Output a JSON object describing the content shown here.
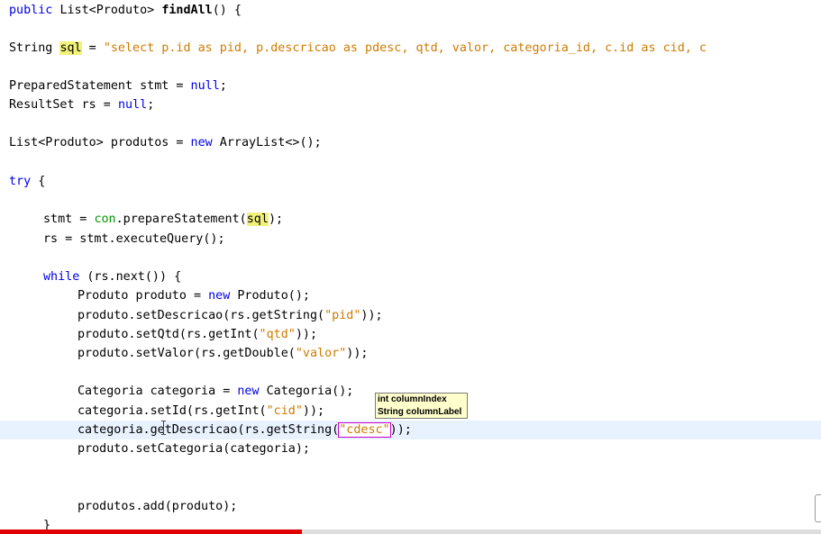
{
  "code": {
    "l1": {
      "kw": "public",
      "type": "List<Produto>",
      "method": "findAll",
      "rest": "() {"
    },
    "l2": {
      "type": "String",
      "var": "sql",
      "op": " = ",
      "str": "\"select p.id as pid, p.descricao as pdesc, qtd, valor, categoria_id, c.id as cid, c"
    },
    "l3": {
      "text": "PreparedStatement stmt = ",
      "kw": "null",
      "end": ";"
    },
    "l4": {
      "text": "ResultSet rs = ",
      "kw": "null",
      "end": ";"
    },
    "l5": {
      "text": "List<Produto> produtos = ",
      "kw": "new",
      "rest": " ArrayList<>();"
    },
    "l6": {
      "kw": "try",
      "rest": " {"
    },
    "l7": {
      "pre": "stmt = ",
      "field": "con",
      "mid": ".prepareStatement(",
      "var": "sql",
      "end": ");"
    },
    "l8": {
      "text": "rs = stmt.executeQuery();"
    },
    "l9": {
      "kw": "while",
      "rest": " (rs.next()) {"
    },
    "l10": {
      "text": "Produto produto = ",
      "kw": "new",
      "rest": " Produto();"
    },
    "l11": {
      "pre": "produto.setDescricao(rs.getString(",
      "str": "\"pid\"",
      "end": "));"
    },
    "l12": {
      "pre": "produto.setQtd(rs.getInt(",
      "str": "\"qtd\"",
      "end": "));"
    },
    "l13": {
      "pre": "produto.setValor(rs.getDouble(",
      "str": "\"valor\"",
      "end": "));"
    },
    "l14": {
      "text": "Categoria categoria = ",
      "kw": "new",
      "rest": " Categoria();"
    },
    "l15": {
      "pre": "categoria.setId(rs.getInt(",
      "str": "\"cid\"",
      "end": "));"
    },
    "l16": {
      "pre": "categoria.",
      "mid": "getDescricao(rs.getString(",
      "str": "\"cdesc\"",
      "end": "));"
    },
    "l17": {
      "text": "produto.setCategoria(categoria);"
    },
    "l18": {
      "text": "produtos.add(produto);"
    },
    "l19": {
      "text": "}"
    }
  },
  "tooltip": {
    "line1": "int columnIndex",
    "line2": "String columnLabel"
  },
  "video_progress": 0.368,
  "colors": {
    "keyword": "#0000e6",
    "string": "#ce7b00",
    "field": "#009900",
    "highlight": "#f1f17c",
    "current_line": "#e8f2fe",
    "progress": "#e00000"
  }
}
